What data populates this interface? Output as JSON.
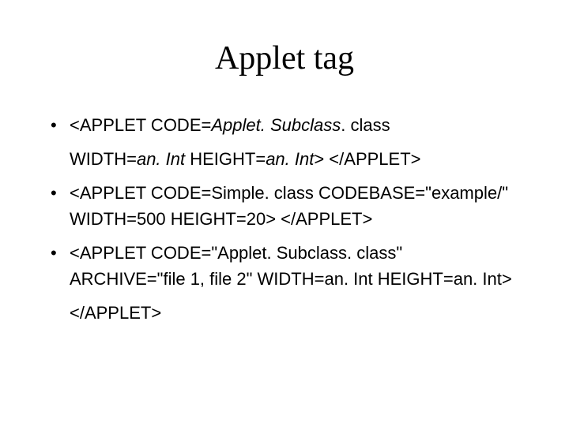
{
  "title": "Applet tag",
  "bullets": [
    {
      "line1_pre": "<APPLET CODE=",
      "line1_em": "Applet. Subclass",
      "line1_post": ". class",
      "line2_pre": "WIDTH=",
      "line2_em1": "an. Int",
      "line2_mid": " HEIGHT=",
      "line2_em2": "an. Int",
      "line2_post": "> </APPLET>"
    },
    {
      "line1": "<APPLET CODE=Simple. class CODEBASE=\"example/\" WIDTH=500 HEIGHT=20> </APPLET>"
    },
    {
      "line1": "<APPLET CODE=\"Applet. Subclass. class\" ARCHIVE=\"file 1, file 2\" WIDTH=an. Int HEIGHT=an. Int>",
      "line2": "</APPLET>"
    }
  ]
}
